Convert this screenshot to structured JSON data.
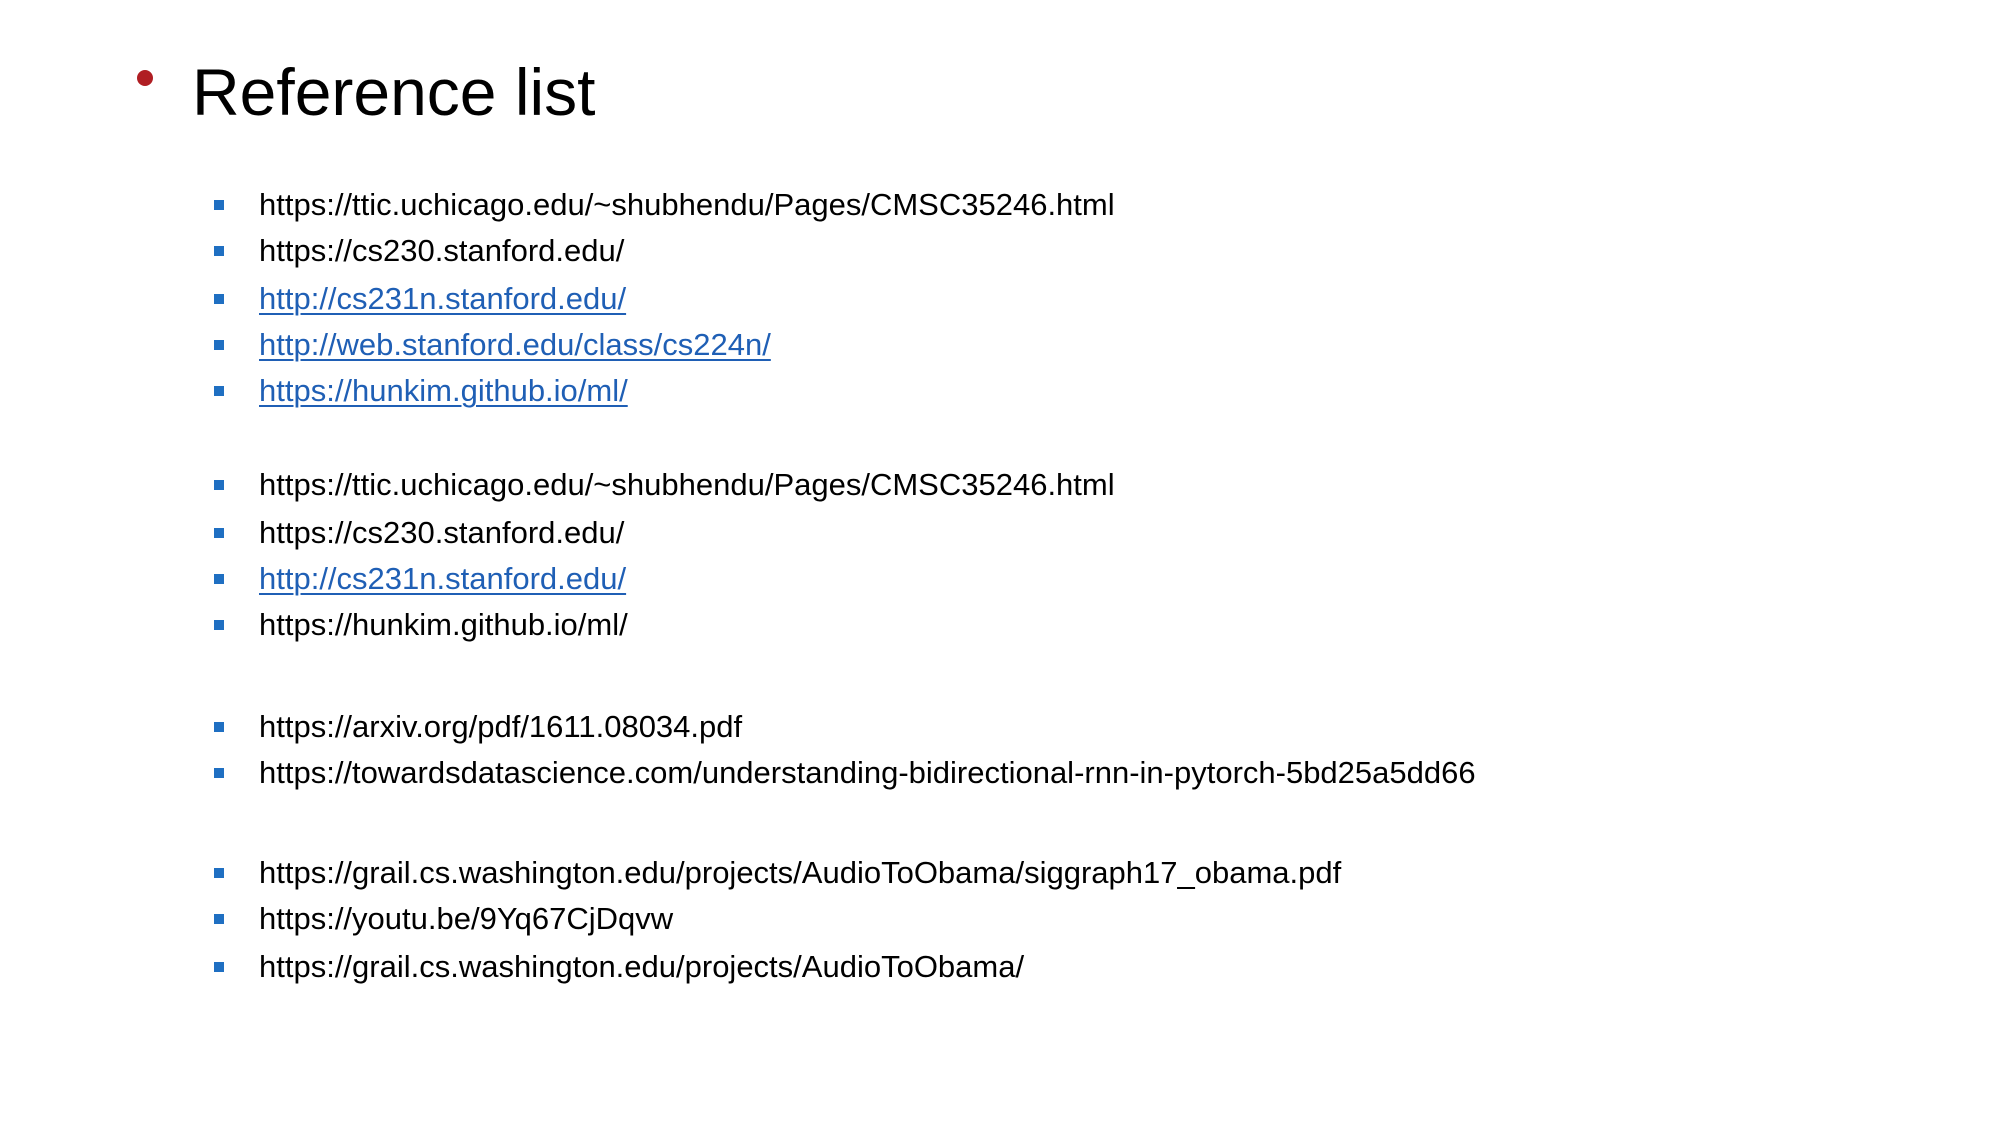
{
  "colors": {
    "title_bullet": "#b01e23",
    "item_marker": "#1f6fc2",
    "link_text": "#1f5fb5",
    "plain_text": "#000000"
  },
  "slide": {
    "title_bullet_glyph": "•",
    "title": "Reference list",
    "references": [
      {
        "text": "https://ttic.uchicago.edu/~shubhendu/Pages/CMSC35246.html",
        "is_link": false
      },
      {
        "text": "https://cs230.stanford.edu/",
        "is_link": false
      },
      {
        "text": "http://cs231n.stanford.edu/",
        "is_link": true
      },
      {
        "text": "http://web.stanford.edu/class/cs224n/",
        "is_link": true
      },
      {
        "text": "https://hunkim.github.io/ml/",
        "is_link": true
      },
      {
        "text": "https://ttic.uchicago.edu/~shubhendu/Pages/CMSC35246.html",
        "is_link": false
      },
      {
        "text": "https://cs230.stanford.edu/",
        "is_link": false
      },
      {
        "text": "http://cs231n.stanford.edu/",
        "is_link": true
      },
      {
        "text": "https://hunkim.github.io/ml/",
        "is_link": false
      },
      {
        "text": "https://arxiv.org/pdf/1611.08034.pdf",
        "is_link": false
      },
      {
        "text": "https://towardsdatascience.com/understanding-bidirectional-rnn-in-pytorch-5bd25a5dd66",
        "is_link": false
      },
      {
        "text": "https://grail.cs.washington.edu/projects/AudioToObama/siggraph17_obama.pdf",
        "is_link": false
      },
      {
        "text": "https://youtu.be/9Yq67CjDqvw",
        "is_link": false
      },
      {
        "text": "https://grail.cs.washington.edu/projects/AudioToObama/",
        "is_link": false
      }
    ]
  }
}
